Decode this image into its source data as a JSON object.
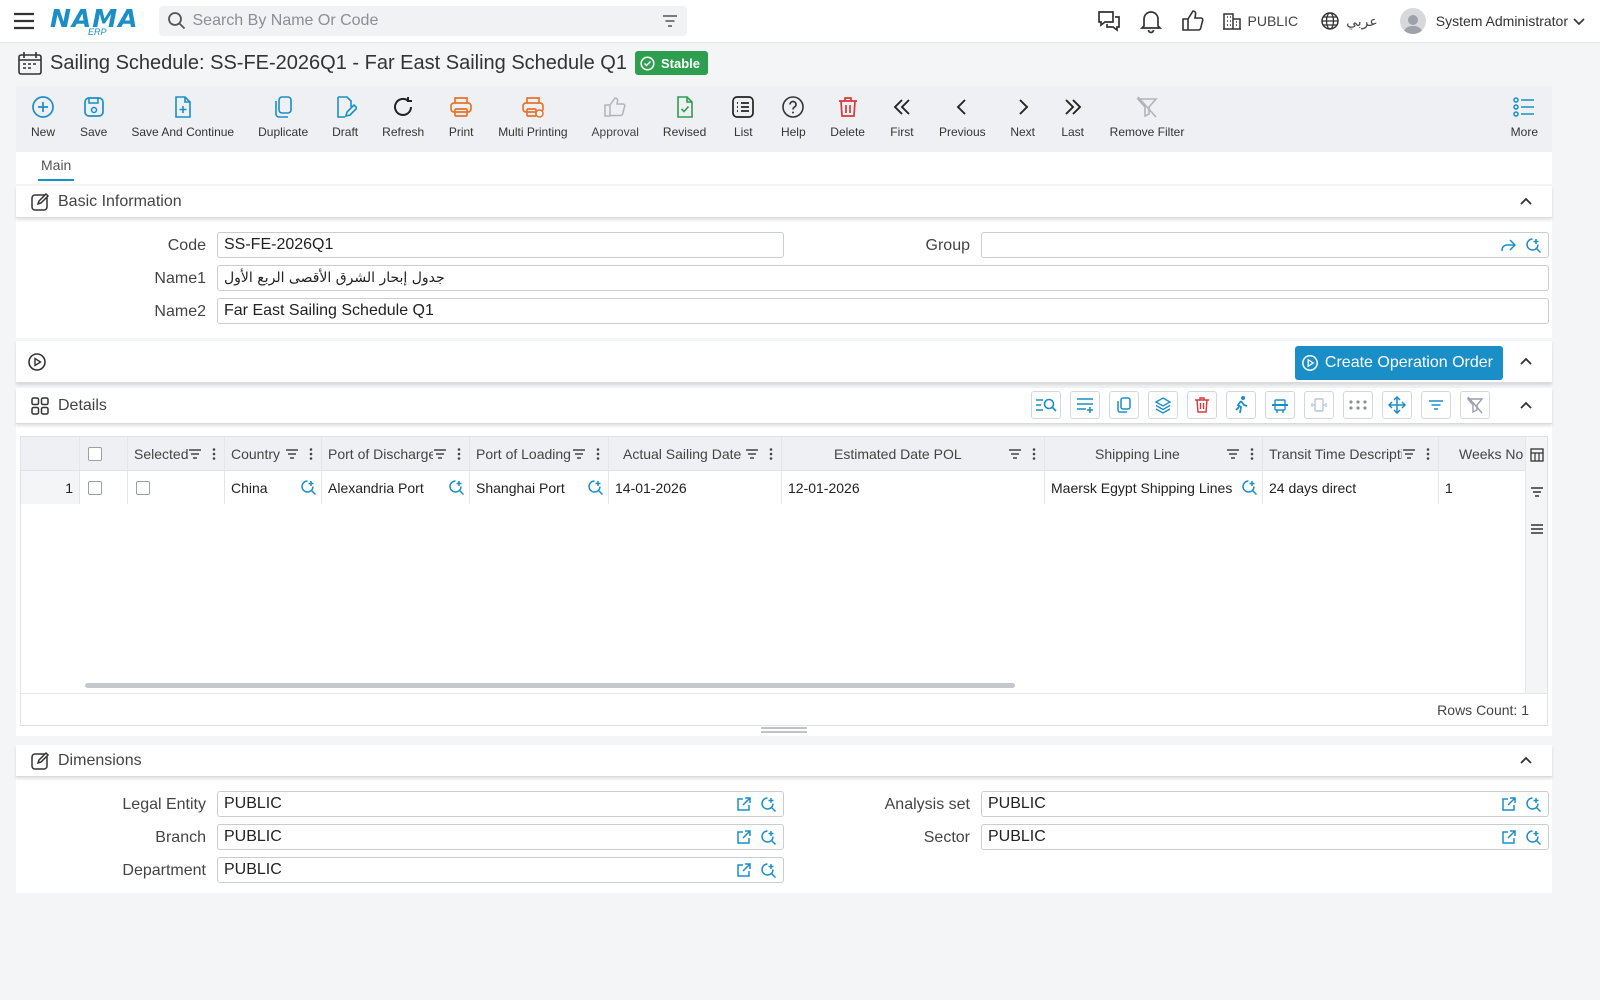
{
  "topbar": {
    "logo_main": "NAMA",
    "logo_sub": "ERP",
    "search_placeholder": "Search By Name Or Code",
    "company": "PUBLIC",
    "language": "عربي",
    "user": "System Administrator"
  },
  "page": {
    "title": "Sailing Schedule: SS-FE-2026Q1 - Far East Sailing Schedule Q1",
    "status": "Stable",
    "status_color": "#2e9e4f"
  },
  "toolbar": {
    "new": "New",
    "save": "Save",
    "save_continue": "Save And Continue",
    "duplicate": "Duplicate",
    "draft": "Draft",
    "refresh": "Refresh",
    "print": "Print",
    "multi_printing": "Multi Printing",
    "approval": "Approval",
    "revised": "Revised",
    "list": "List",
    "help": "Help",
    "delete": "Delete",
    "first": "First",
    "previous": "Previous",
    "next": "Next",
    "last": "Last",
    "remove_filter": "Remove Filter",
    "more": "More"
  },
  "tabs": {
    "main": "Main"
  },
  "basic": {
    "title": "Basic Information",
    "code_label": "Code",
    "code_value": "SS-FE-2026Q1",
    "group_label": "Group",
    "group_value": "",
    "name1_label": "Name1",
    "name1_value": "جدول إبحار الشرق الأقصى الربع الأول",
    "name2_label": "Name2",
    "name2_value": "Far East Sailing Schedule Q1"
  },
  "operation": {
    "button": "Create Operation Order"
  },
  "details": {
    "title": "Details",
    "columns": {
      "selected": "Selected",
      "country": "Country",
      "pod": "Port of Discharge",
      "pol": "Port of Loading",
      "actual_sailing": "Actual Sailing Date",
      "estimated_pol": "Estimated Date POL",
      "shipping_line": "Shipping Line",
      "transit_desc": "Transit Time Description",
      "weeks_no": "Weeks No"
    },
    "rows": [
      {
        "num": "1",
        "country": "China",
        "pod": "Alexandria Port",
        "pol": "Shanghai Port",
        "actual_sailing": "14-01-2026",
        "estimated_pol": "12-01-2026",
        "shipping_line": "Maersk Egypt Shipping Lines",
        "transit_desc": "24 days direct",
        "weeks_no": "1"
      }
    ],
    "rows_count": "Rows Count: 1"
  },
  "dimensions": {
    "title": "Dimensions",
    "legal_entity_label": "Legal Entity",
    "legal_entity_value": "PUBLIC",
    "branch_label": "Branch",
    "branch_value": "PUBLIC",
    "department_label": "Department",
    "department_value": "PUBLIC",
    "analysis_set_label": "Analysis set",
    "analysis_set_value": "PUBLIC",
    "sector_label": "Sector",
    "sector_value": "PUBLIC"
  },
  "colors": {
    "accent": "#1a8fc7",
    "print_orange": "#e8732c",
    "delete_red": "#d9383a",
    "revised_green": "#2e9e4f"
  }
}
